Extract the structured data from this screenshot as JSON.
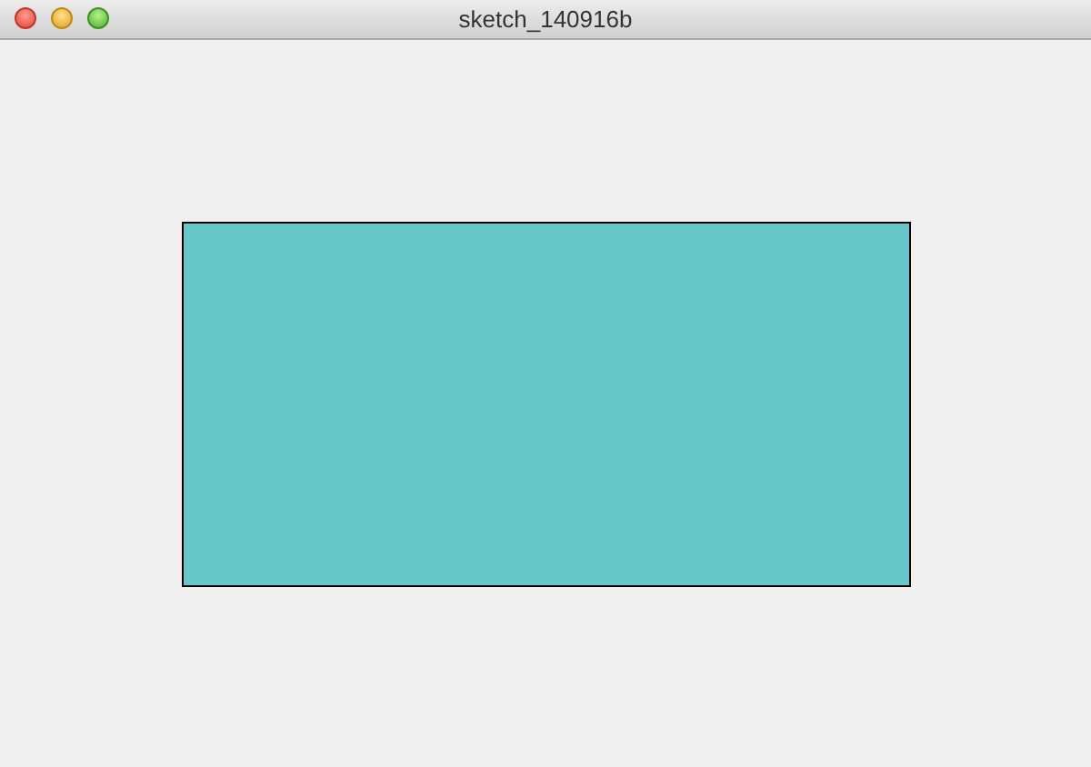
{
  "window": {
    "title": "sketch_140916b"
  },
  "canvas": {
    "shapes": [
      {
        "kind": "rectangle"
      }
    ]
  }
}
